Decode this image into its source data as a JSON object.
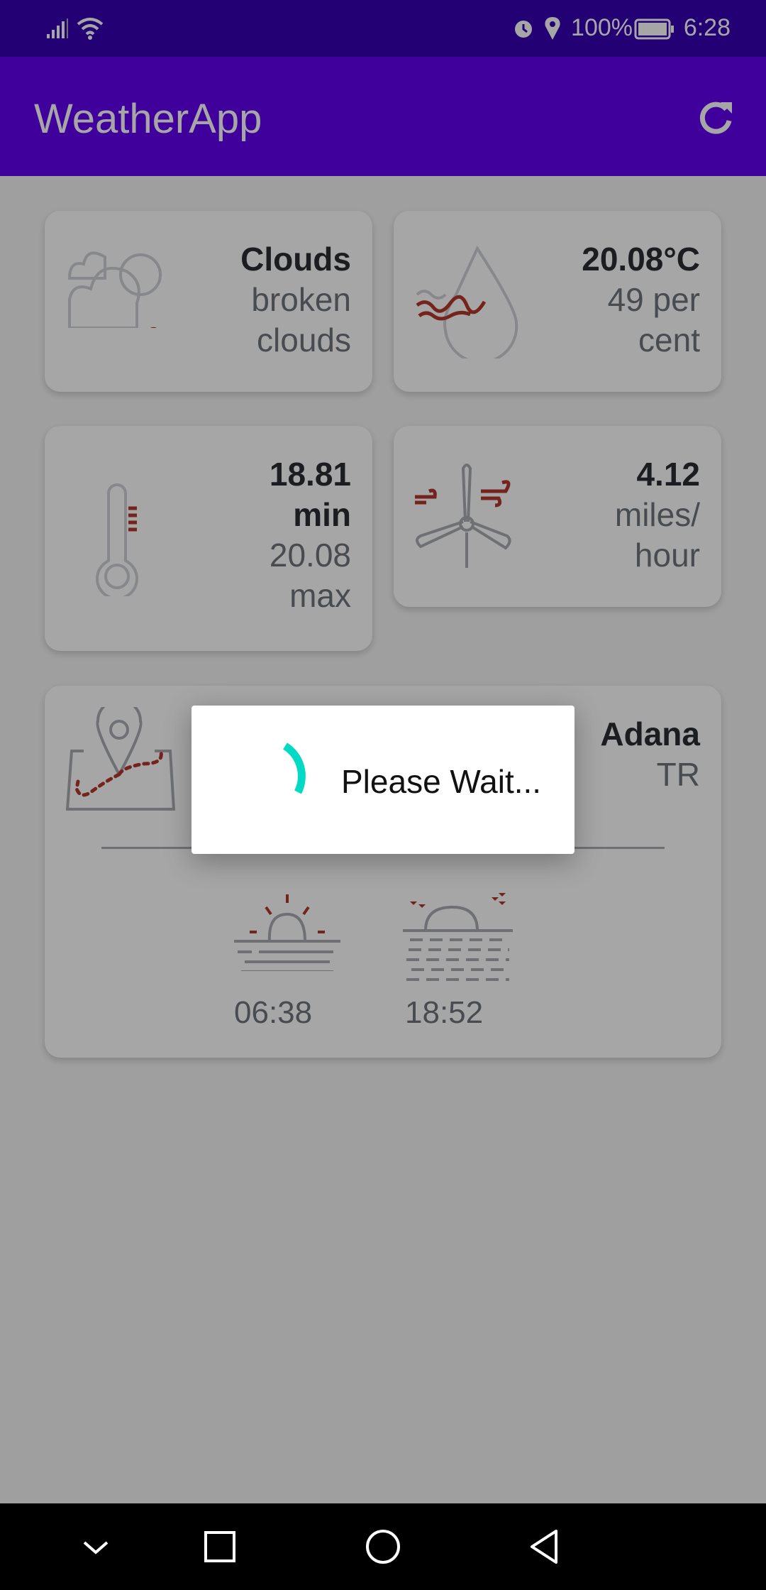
{
  "status_bar": {
    "battery": "100%",
    "time": "6:28",
    "icons": [
      "signal-icon",
      "wifi-icon",
      "alarm-icon",
      "location-icon",
      "battery-icon"
    ]
  },
  "app_bar": {
    "title": "WeatherApp",
    "refresh_icon": "refresh-icon"
  },
  "cards": {
    "condition": {
      "main": "Clouds",
      "description": "broken clouds"
    },
    "temperature": {
      "main": "20.08°C",
      "humidity": "49 per cent"
    },
    "minmax": {
      "min": "18.81 min",
      "max": "20.08 max"
    },
    "wind": {
      "speed": "4.12",
      "unit": "miles/ hour"
    },
    "location": {
      "city": "Adana",
      "country": "TR",
      "sunrise": "06:38",
      "sunset": "18:52"
    }
  },
  "dialog": {
    "message": "Please Wait..."
  },
  "colors": {
    "primary": "#6200ee",
    "primary_dark": "#3700b3",
    "accent": "#03dac5",
    "icon_red": "#b3382c",
    "icon_gray": "#a9adb2"
  },
  "nav_bar": {
    "icons": [
      "collapse-icon",
      "recents-icon",
      "home-icon",
      "back-icon"
    ]
  }
}
